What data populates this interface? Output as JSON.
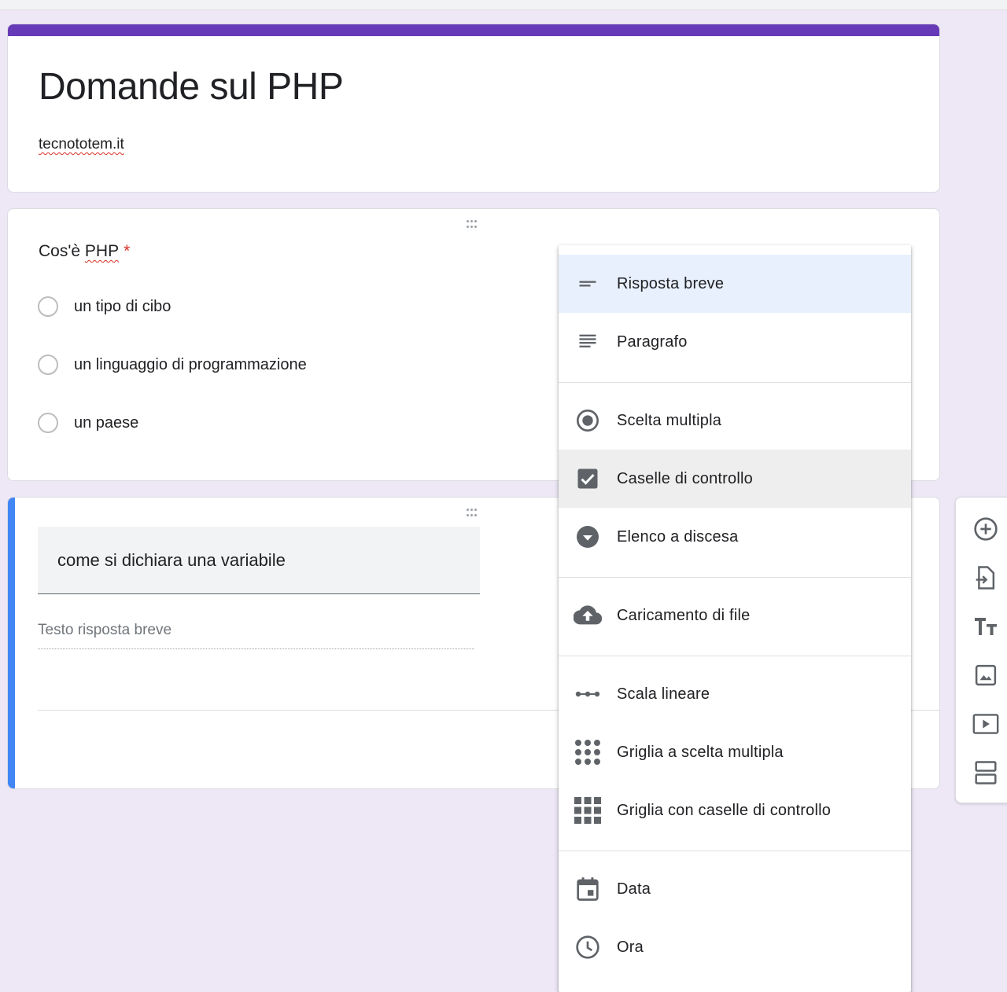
{
  "form": {
    "title": "Domande sul PHP",
    "description": "tecnototem.it",
    "accent_color": "#673ab7",
    "background_color": "#ede7f6"
  },
  "question1": {
    "title": "Cos'è",
    "title_underlined": "PHP",
    "required_mark": "*",
    "options": [
      "un tipo di cibo",
      "un linguaggio di programmazione",
      "un paese"
    ]
  },
  "question2": {
    "title_value": "come si dichiara una variabile",
    "answer_placeholder": "Testo risposta breve",
    "active_color": "#4285f4"
  },
  "type_menu": {
    "items": [
      {
        "label": "Risposta breve",
        "icon": "short-text-icon",
        "state": "selected"
      },
      {
        "label": "Paragrafo",
        "icon": "paragraph-icon"
      },
      {
        "label": "Scelta multipla",
        "icon": "radio-button-icon"
      },
      {
        "label": "Caselle di controllo",
        "icon": "checkbox-icon",
        "state": "hover"
      },
      {
        "label": "Elenco a discesa",
        "icon": "dropdown-arrow-icon"
      },
      {
        "label": "Caricamento di file",
        "icon": "cloud-upload-icon"
      },
      {
        "label": "Scala lineare",
        "icon": "linear-scale-icon"
      },
      {
        "label": "Griglia a scelta multipla",
        "icon": "radio-grid-icon"
      },
      {
        "label": "Griglia con caselle di controllo",
        "icon": "checkbox-grid-icon"
      },
      {
        "label": "Data",
        "icon": "calendar-icon"
      },
      {
        "label": "Ora",
        "icon": "clock-icon"
      }
    ]
  },
  "toolbar": {
    "items": [
      "add-question-icon",
      "import-questions-icon",
      "add-title-icon",
      "add-image-icon",
      "add-video-icon",
      "add-section-icon"
    ]
  }
}
